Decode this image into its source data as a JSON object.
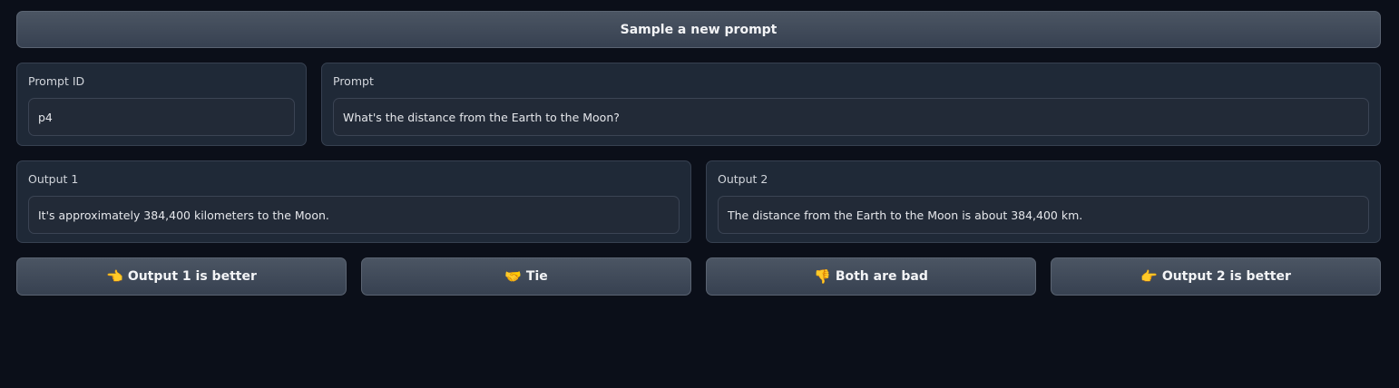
{
  "sample_button": {
    "label": "Sample a new prompt"
  },
  "prompt_id": {
    "label": "Prompt ID",
    "value": "p4"
  },
  "prompt": {
    "label": "Prompt",
    "value": "What's the distance from the Earth to the Moon?"
  },
  "output1": {
    "label": "Output 1",
    "value": "It's approximately 384,400 kilometers to the Moon."
  },
  "output2": {
    "label": "Output 2",
    "value": "The distance from the Earth to the Moon is about 384,400 km."
  },
  "vote_buttons": [
    {
      "emoji": "👈",
      "label": "Output 1 is better"
    },
    {
      "emoji": "🤝",
      "label": "Tie"
    },
    {
      "emoji": "👎",
      "label": "Both are bad"
    },
    {
      "emoji": "👉",
      "label": "Output 2 is better"
    }
  ]
}
